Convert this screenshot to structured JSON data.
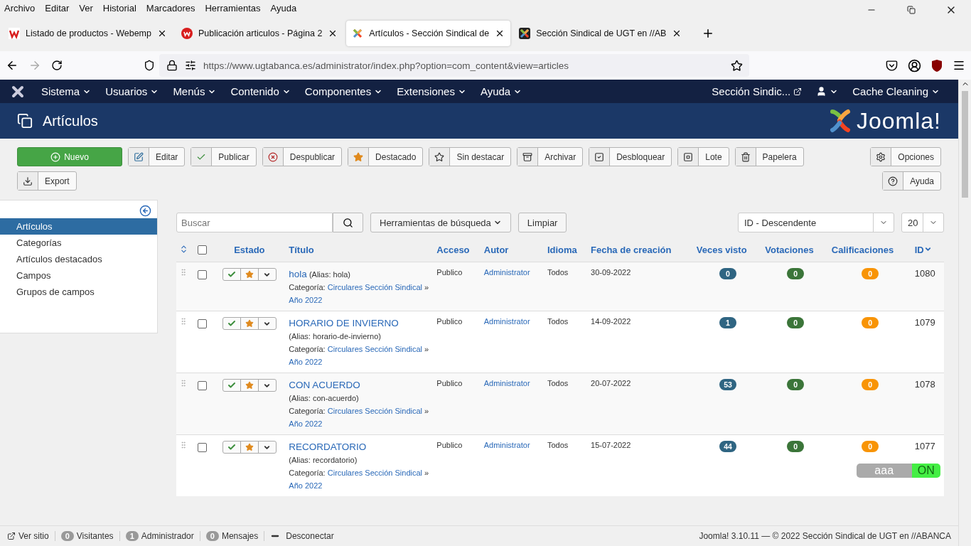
{
  "menu_bar": [
    "Archivo",
    "Editar",
    "Ver",
    "Historial",
    "Marcadores",
    "Herramientas",
    "Ayuda"
  ],
  "browser_tabs": [
    {
      "title": "Listado de productos - Webemp",
      "selected": false,
      "kind": "webempresa"
    },
    {
      "title": "Publicación articulos - Página 2",
      "selected": false,
      "kind": "webempresa-round"
    },
    {
      "title": "Artículos - Sección Sindical de",
      "selected": true,
      "kind": "joomla"
    },
    {
      "title": "Sección Sindical de UGT en //AB",
      "selected": false,
      "kind": "joomla-dark"
    }
  ],
  "address_bar": {
    "url": "https://www.ugtabanca.es/administrator/index.php?option=com_content&view=articles"
  },
  "admin_menu": {
    "items": [
      "Sistema",
      "Usuarios",
      "Menús",
      "Contenido",
      "Componentes",
      "Extensiones",
      "Ayuda"
    ],
    "site_link": "Sección Sindic...",
    "user_menu": true,
    "cache_menu": "Cache Cleaning"
  },
  "header": {
    "title": "Artículos",
    "brand": "Joomla!"
  },
  "toolbar": [
    {
      "label": "Nuevo",
      "kind": "primary"
    },
    {
      "label": "Editar",
      "kind": "default"
    },
    {
      "label": "Publicar",
      "kind": "default"
    },
    {
      "label": "Despublicar",
      "kind": "default"
    },
    {
      "label": "Destacado",
      "kind": "default"
    },
    {
      "label": "Sin destacar",
      "kind": "default"
    },
    {
      "label": "Archivar",
      "kind": "default"
    },
    {
      "label": "Desbloquear",
      "kind": "default"
    },
    {
      "label": "Lote",
      "kind": "default"
    },
    {
      "label": "Papelera",
      "kind": "default"
    },
    {
      "label": "Export",
      "kind": "default"
    }
  ],
  "toolbar_right": [
    {
      "label": "Opciones"
    },
    {
      "label": "Ayuda"
    }
  ],
  "sidebar": {
    "items": [
      {
        "label": "Artículos",
        "selected": true
      },
      {
        "label": "Categorías",
        "selected": false
      },
      {
        "label": "Artículos destacados",
        "selected": false
      },
      {
        "label": "Campos",
        "selected": false
      },
      {
        "label": "Grupos de campos",
        "selected": false
      }
    ]
  },
  "filters": {
    "search_placeholder": "Buscar",
    "tools_button": "Herramientas de búsqueda",
    "clear_button": "Limpiar",
    "ordering": "ID - Descendente",
    "limit": "20"
  },
  "table": {
    "select_all_checked": false,
    "columns": [
      "Estado",
      "Título",
      "Acceso",
      "Autor",
      "Idioma",
      "Fecha de creación",
      "Veces visto",
      "Votaciones",
      "Calificaciones",
      "ID"
    ],
    "rows": [
      {
        "title": "hola",
        "alias": "(Alias: hola)",
        "category_label": "Categoría:",
        "category": "Circulares Sección Sindical",
        "separator": "»",
        "subcategory": "Año 2022",
        "access": "Publico",
        "author": "Administrator",
        "language": "Todos",
        "created": "30-09-2022",
        "hits": "0",
        "votes": "0",
        "ratings": "0",
        "id": "1080",
        "published": true,
        "featured": true,
        "checked": false
      },
      {
        "title": "HORARIO DE INVIERNO",
        "alias": "(Alias: horario-de-invierno)",
        "category_label": "Categoría:",
        "category": "Circulares Sección Sindical",
        "separator": "»",
        "subcategory": "Año 2022",
        "access": "Publico",
        "author": "Administrator",
        "language": "Todos",
        "created": "14-09-2022",
        "hits": "1",
        "votes": "0",
        "ratings": "0",
        "id": "1079",
        "published": true,
        "featured": true,
        "checked": false
      },
      {
        "title": "CON ACUERDO",
        "alias": "(Alias: con-acuerdo)",
        "category_label": "Categoría:",
        "category": "Circulares Sección Sindical",
        "separator": "»",
        "subcategory": "Año 2022",
        "access": "Publico",
        "author": "Administrator",
        "language": "Todos",
        "created": "20-07-2022",
        "hits": "53",
        "votes": "0",
        "ratings": "0",
        "id": "1078",
        "published": true,
        "featured": true,
        "checked": false
      },
      {
        "title": "RECORDATORIO",
        "alias": "(Alias: recordatorio)",
        "category_label": "Categoría:",
        "category": "Circulares Sección Sindical",
        "separator": "»",
        "subcategory": "Año 2022",
        "access": "Publico",
        "author": "Administrator",
        "language": "Todos",
        "created": "15-07-2022",
        "hits": "44",
        "votes": "0",
        "ratings": "0",
        "id": "1077",
        "published": true,
        "featured": true,
        "checked": false,
        "toggle": {
          "label": "aaa",
          "state": "ON",
          "on": true
        }
      }
    ]
  },
  "status_bar": {
    "view_site": "Ver sitio",
    "visitors_count": "0",
    "visitors": "Visitantes",
    "admins_count": "1",
    "admins": "Administrador",
    "messages_count": "0",
    "messages": "Mensajes",
    "logout": "Desconectar",
    "footer": "Joomla! 3.10.11 — © 2022 Sección Sindical de UGT en //ABANCA"
  }
}
